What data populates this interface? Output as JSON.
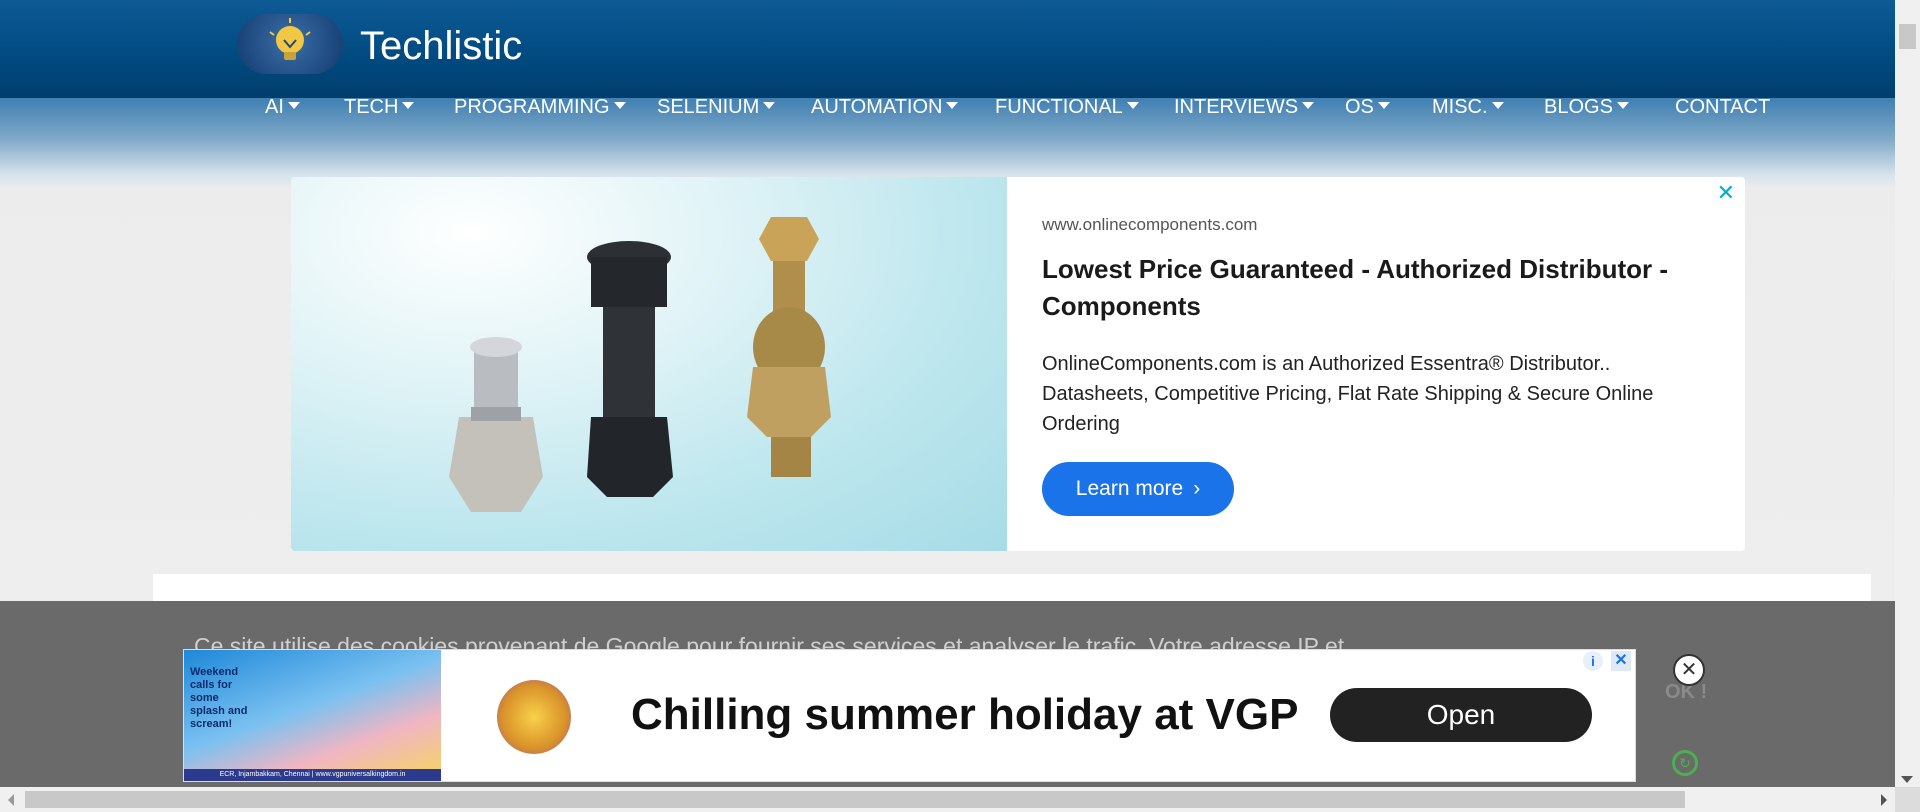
{
  "site": {
    "title": "Techlistic"
  },
  "nav": [
    {
      "label": "AI",
      "dropdown": true
    },
    {
      "label": "TECH",
      "dropdown": true
    },
    {
      "label": "PROGRAMMING",
      "dropdown": true
    },
    {
      "label": "SELENIUM",
      "dropdown": true
    },
    {
      "label": "AUTOMATION",
      "dropdown": true
    },
    {
      "label": "FUNCTIONAL",
      "dropdown": true
    },
    {
      "label": "INTERVIEWS",
      "dropdown": true
    },
    {
      "label": "OS",
      "dropdown": true
    },
    {
      "label": "MISC.",
      "dropdown": true
    },
    {
      "label": "BLOGS",
      "dropdown": true
    },
    {
      "label": "CONTACT",
      "dropdown": false
    }
  ],
  "ad": {
    "domain": "www.onlinecomponents.com",
    "title": "Lowest Price Guaranteed - Authorized Distributor - Components",
    "description": "OnlineComponents.com is an Authorized Essentra® Distributor.. Datasheets, Competitive Pricing, Flat Rate Shipping & Secure Online Ordering",
    "button": "Learn more",
    "close": "✕"
  },
  "cookie": {
    "text": "Ce site utilise des cookies provenant de Google pour fournir ses services et analyser le trafic. Votre adresse IP et",
    "ok": "OK !"
  },
  "banner": {
    "image_text": "Weekend calls for some splash and scream!",
    "image_footer": "ECR, Injambakkam, Chennai | www.vgpuniversalkingdom.in",
    "headline": "Chilling summer holiday at VGP",
    "button": "Open"
  },
  "colors": {
    "header": "#004a80",
    "ad_button": "#1a73e8",
    "cookie_bar": "#6a6a6a",
    "banner_button": "#222222"
  }
}
